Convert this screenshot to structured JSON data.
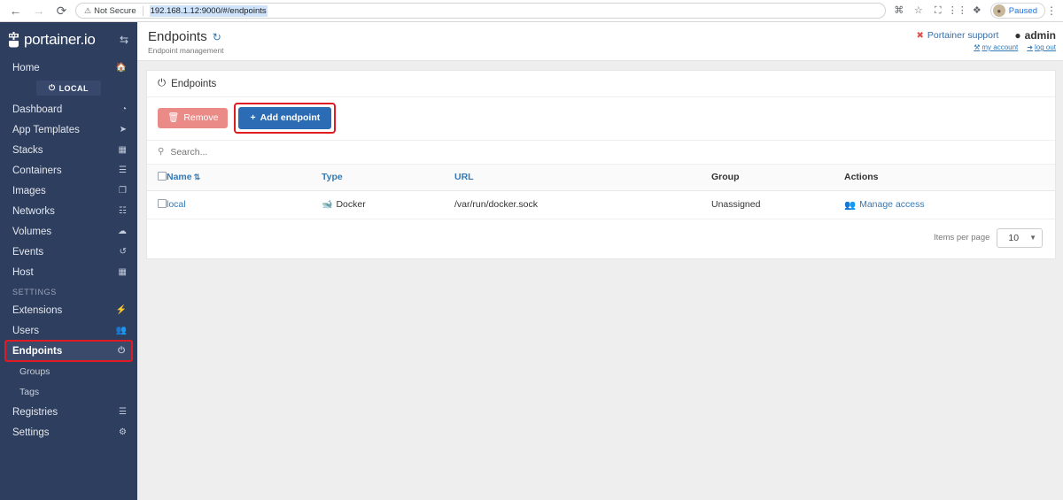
{
  "browser": {
    "back_icon": "back-arrow-icon",
    "forward_icon": "forward-arrow-icon",
    "reload_icon": "reload-icon",
    "security_label": "Not Secure",
    "url": "192.168.1.12:9000/#/endpoints",
    "profile_label": "Paused",
    "icons": [
      "grid-icon",
      "star-icon",
      "cast-icon",
      "extension-puzzle-icon",
      "menu-kebab-icon"
    ]
  },
  "sidebar": {
    "brand": "portainer.io",
    "toggle_icon": "exchange-toggle-icon",
    "home": {
      "label": "Home",
      "icon": "home-icon"
    },
    "local_badge": {
      "label": "LOCAL",
      "icon": "plug-icon"
    },
    "items": [
      {
        "label": "Dashboard",
        "icon": "dashboard-icon"
      },
      {
        "label": "App Templates",
        "icon": "rocket-icon"
      },
      {
        "label": "Stacks",
        "icon": "list-icon"
      },
      {
        "label": "Containers",
        "icon": "containers-icon"
      },
      {
        "label": "Images",
        "icon": "images-icon"
      },
      {
        "label": "Networks",
        "icon": "network-icon"
      },
      {
        "label": "Volumes",
        "icon": "volumes-icon"
      },
      {
        "label": "Events",
        "icon": "history-icon"
      },
      {
        "label": "Host",
        "icon": "grid-icon"
      }
    ],
    "settings_label": "SETTINGS",
    "settings_items": [
      {
        "label": "Extensions",
        "icon": "bolt-icon"
      },
      {
        "label": "Users",
        "icon": "users-icon"
      },
      {
        "label": "Endpoints",
        "icon": "plug-icon"
      }
    ],
    "endpoints_subitems": [
      {
        "label": "Groups"
      },
      {
        "label": "Tags"
      }
    ],
    "settings_items_tail": [
      {
        "label": "Registries",
        "icon": "database-icon"
      },
      {
        "label": "Settings",
        "icon": "gear-icon"
      }
    ]
  },
  "header": {
    "title": "Endpoints",
    "refresh_icon": "refresh-icon",
    "subtitle": "Endpoint management",
    "support_label": "Portainer support",
    "support_icon": "error-circle-icon",
    "user_label": "admin",
    "user_icon": "user-circle-icon",
    "my_account_label": "my account",
    "my_account_icon": "wrench-icon",
    "logout_label": "log out",
    "logout_icon": "logout-icon"
  },
  "panel": {
    "title": "Endpoints",
    "title_icon": "plug-icon",
    "remove_label": "Remove",
    "remove_icon": "trash-icon",
    "add_label": "Add endpoint",
    "add_icon": "plus-icon",
    "search_placeholder": "Search...",
    "search_icon": "search-icon",
    "search_value": ""
  },
  "table": {
    "columns": [
      {
        "label": "Name",
        "sort_icon": "sort-icon"
      },
      {
        "label": "Type"
      },
      {
        "label": "URL"
      },
      {
        "label": "Group"
      },
      {
        "label": "Actions"
      }
    ],
    "rows": [
      {
        "name": "local",
        "type": "Docker",
        "type_icon": "docker-whale-icon",
        "url": "/var/run/docker.sock",
        "group": "Unassigned",
        "action_label": "Manage access",
        "action_icon": "manage-access-icon"
      }
    ]
  },
  "pager": {
    "label": "Items per page",
    "value": "10"
  },
  "colors": {
    "sidebar_bg": "#2d3e5f",
    "accent_blue": "#337ab7",
    "button_blue": "#2b6cb5",
    "remove_red": "#eb8b88",
    "annotation_red": "#e01b24",
    "content_bg": "#eeeeee"
  }
}
